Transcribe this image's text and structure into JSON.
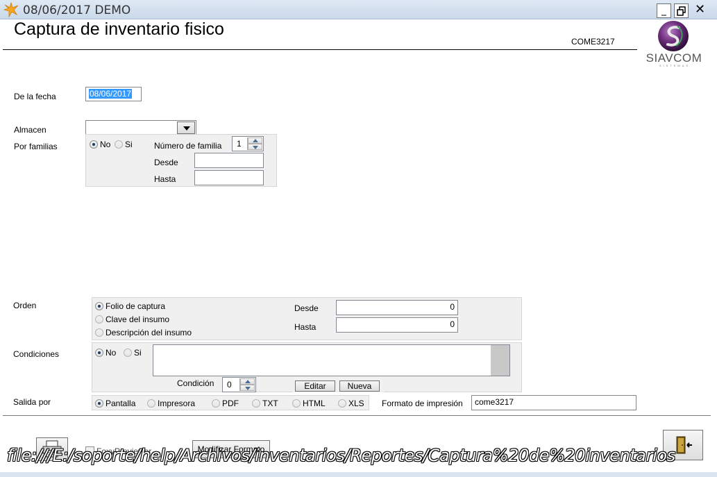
{
  "window": {
    "title": "08/06/2017  DEMO",
    "minimize_glyph": "_",
    "restore_glyph": "🗗",
    "close_glyph": "✕"
  },
  "header": {
    "title": "Captura de inventario fisico",
    "code": "COME3217",
    "logo_text": "SIAVCOM",
    "logo_subtext": "SISTEMAS"
  },
  "fields": {
    "fecha_label": "De la fecha",
    "fecha_value": "08/06/2017",
    "almacen_label": "Almacen",
    "almacen_value": "",
    "familias_label": "Por familias"
  },
  "familias": {
    "opt_no": "No",
    "opt_si": "Si",
    "selected": "No",
    "numero_label": "Número de familia",
    "numero_value": "1",
    "desde_label": "Desde",
    "desde_value": "",
    "hasta_label": "Hasta",
    "hasta_value": ""
  },
  "orden": {
    "label": "Orden",
    "options": [
      "Folio de captura",
      "Clave del insumo",
      "Descripción del insumo"
    ],
    "selected": "Folio de captura",
    "desde_label": "Desde",
    "desde_value": "0",
    "hasta_label": "Hasta",
    "hasta_value": "0"
  },
  "condiciones": {
    "label": "Condiciones",
    "opt_no": "No",
    "opt_si": "Si",
    "selected": "No",
    "text": "",
    "condicion_label": "Condición",
    "condicion_value": "0",
    "editar_label": "Editar",
    "nueva_label": "Nueva"
  },
  "salida": {
    "label": "Salida por",
    "options": [
      "Pantalla",
      "Impresora",
      "PDF",
      "TXT",
      "HTML",
      "XLS"
    ],
    "selected": "Pantalla",
    "formato_label": "Formato de impresión",
    "formato_value": "come3217"
  },
  "footer": {
    "foxy_label": "FoxyPreviewer",
    "modificar_label": "Modificar Formato",
    "status_url": "file:///E:/soporte/help/Archivos/inventarios/Reportes/Captura%20de%20inventarios"
  },
  "icons": {
    "app": "star-swirl-icon",
    "print": "printer-icon",
    "exit": "exit-door-icon"
  },
  "colors": {
    "selection": "#3399ff",
    "logo_purple": "#6a2c7a",
    "logo_green": "#3d9b5b"
  }
}
